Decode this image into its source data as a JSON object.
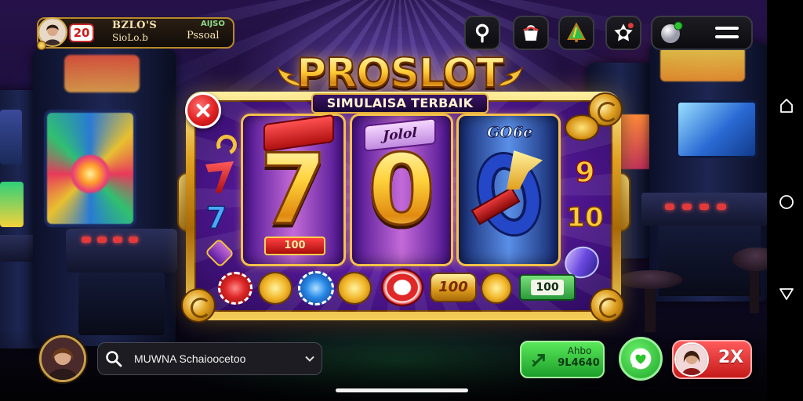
{
  "player": {
    "level": "20",
    "name": "BZLO'S",
    "subtitle": "SioLo.b",
    "stat_label": "AIJSO",
    "stat_value": "Pssoal"
  },
  "toolbar": {
    "icons": [
      "location-icon",
      "bag-icon",
      "tree-icon",
      "star-badge-icon",
      "ball-icon",
      "menu-icon"
    ]
  },
  "logo": {
    "title": "PROSLOT",
    "subtitle": "SIMULAISA TERBAIK"
  },
  "reels": [
    {
      "symbol": "7",
      "bottom_label": "100"
    },
    {
      "symbol": "0",
      "top_label": "Jolol"
    },
    {
      "top_label": "GO6e"
    }
  ],
  "side_symbols": {
    "left": [
      "7"
    ],
    "right": [
      "9",
      "10"
    ]
  },
  "coin_row": {
    "badge_label": "100",
    "money_label": "100"
  },
  "search": {
    "value": "MUWNA Schaioocetoo"
  },
  "actions": {
    "play_top": "Ahbo",
    "play_bottom": "9L4640",
    "multiplier": "2X"
  },
  "colors": {
    "gold": "#f7c948",
    "purple": "#6a1fa8",
    "green": "#2ecc40",
    "red": "#e02020"
  }
}
